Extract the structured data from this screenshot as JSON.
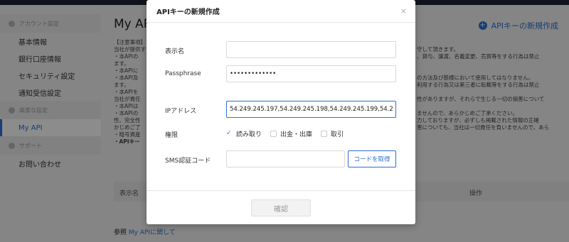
{
  "sidebar": {
    "sections": [
      {
        "label": "アカウント設定",
        "items": [
          "基本情報",
          "銀行口座情報",
          "セキュリティ設定",
          "通知受信設定"
        ]
      },
      {
        "label": "高度な設定",
        "items": [
          "My API"
        ]
      },
      {
        "label": "サポート",
        "items": [
          "お問い合わせ"
        ]
      }
    ]
  },
  "main": {
    "title": "My API",
    "create_link": "APIキーの新規作成",
    "notice": [
      "【注意事項】",
      "当社が提供す",
      "・本APIの",
      "ます。",
      "・本APIに",
      "・本API及",
      "ます。",
      "・本APIを",
      "当社が責任",
      "・本APIは",
      "・本APIの",
      "性、完全性",
      "かじめご了",
      "・暗号資産",
      "・APIキー"
    ],
    "notice_right": [
      "守して頂きます。",
      "、貸与、譲渡、名義変更、売買等をする行為は禁止",
      "の方法及び態様において使用してはなりません。",
      "利用する行為又は第三者に転載等をする行為は禁止",
      "性がありますが、それらで生じる一切の損害について",
      "ませんので、あらかじめご了承ください。",
      "力しておりますが、必ずしも掲載された情報の正確",
      "害についても、当社は一切責任を負いませんので、あら"
    ],
    "table_headers": [
      "表示名",
      "操作"
    ],
    "ref_prefix": "参照",
    "ref_link": "My APIに関して"
  },
  "modal": {
    "title": "APIキーの新規作成",
    "close": "×",
    "labels": {
      "name": "表示名",
      "passphrase": "Passphrase",
      "ip": "IPアドレス",
      "perm": "権限",
      "sms": "SMS認証コード"
    },
    "values": {
      "name": "",
      "passphrase": "•••••••••••••",
      "ip": "54.249.245.197,54.249.245.198,54.249.245.199,54.249.2",
      "sms": ""
    },
    "permissions": [
      {
        "label": "読み取り",
        "checked": true
      },
      {
        "label": "出金・出庫",
        "checked": false
      },
      {
        "label": "取引",
        "checked": false
      }
    ],
    "code_button": "コードを取得",
    "confirm_button": "確認"
  },
  "colors": {
    "accent": "#2f6fd6",
    "overlay": "rgba(0,0,0,0.45)"
  }
}
